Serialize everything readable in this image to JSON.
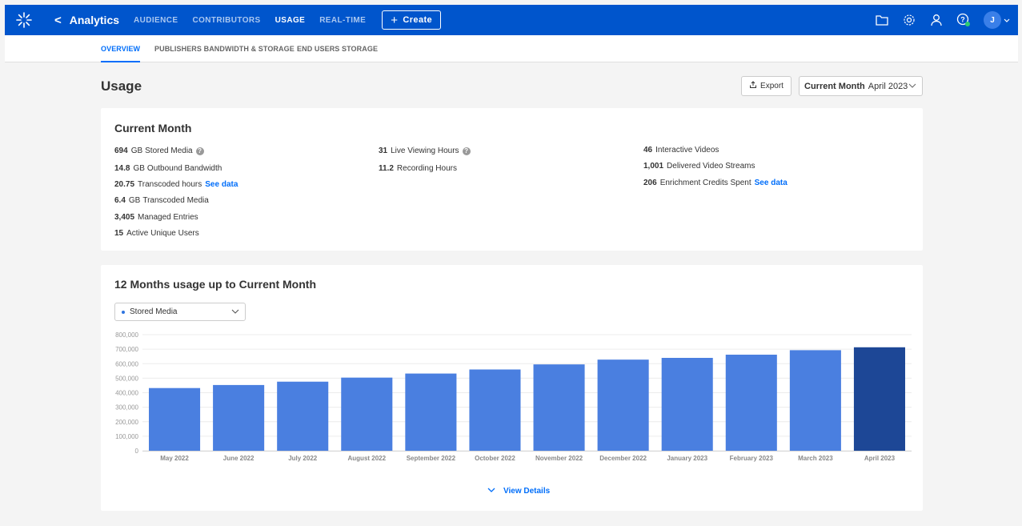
{
  "topbar": {
    "app_title": "Analytics",
    "back_glyph": "<",
    "nav": [
      "AUDIENCE",
      "CONTRIBUTORS",
      "USAGE",
      "REAL-TIME"
    ],
    "active_nav": "USAGE",
    "create_label": "Create",
    "avatar_initial": "J",
    "icons": [
      "kaltura-logo-icon",
      "folder-icon",
      "gear-icon",
      "user-icon",
      "help-icon",
      "chevron-down-icon"
    ],
    "accent_color": "#0055cc"
  },
  "subnav": {
    "tabs": [
      "OVERVIEW",
      "PUBLISHERS BANDWIDTH & STORAGE",
      "END USERS STORAGE"
    ],
    "active": "OVERVIEW"
  },
  "header": {
    "title": "Usage",
    "export_label": "Export",
    "period_label": "Current Month",
    "period_value": "April 2023"
  },
  "current_month": {
    "title": "Current Month",
    "col1": [
      {
        "value": "694",
        "unit": "GB",
        "label": "Stored Media",
        "help": true
      },
      {
        "value": "14.8",
        "unit": "GB",
        "label": "Outbound Bandwidth"
      },
      {
        "value": "20.75",
        "label": "Transcoded hours",
        "link": "See data"
      },
      {
        "value": "6.4",
        "unit": "GB",
        "label": "Transcoded Media"
      },
      {
        "value": "3,405",
        "label": "Managed Entries"
      },
      {
        "value": "15",
        "label": "Active Unique Users"
      }
    ],
    "col2": [
      {
        "value": "31",
        "label": "Live Viewing Hours",
        "help": true
      },
      {
        "value": "11.2",
        "label": "Recording Hours"
      }
    ],
    "col3": [
      {
        "value": "46",
        "label": "Interactive Videos"
      },
      {
        "value": "1,001",
        "label": "Delivered Video Streams"
      },
      {
        "value": "206",
        "label": "Enrichment Credits Spent",
        "link": "See data"
      }
    ]
  },
  "usage_chart": {
    "title": "12 Months usage up to Current Month",
    "metric_selected": "Stored Media",
    "view_details_label": "View Details"
  },
  "chart_data": {
    "type": "bar",
    "categories": [
      "May 2022",
      "June 2022",
      "July 2022",
      "August 2022",
      "September 2022",
      "October 2022",
      "November 2022",
      "December 2022",
      "January 2023",
      "February 2023",
      "March 2023",
      "April 2023"
    ],
    "values": [
      432000,
      453000,
      476000,
      504000,
      532000,
      560000,
      595000,
      628000,
      640000,
      662000,
      693000,
      713000
    ],
    "yticks": [
      "0",
      "100,000",
      "200,000",
      "300,000",
      "400,000",
      "500,000",
      "600,000",
      "700,000",
      "800,000"
    ],
    "ylim": [
      0,
      800000
    ],
    "grid": true,
    "bar_color": "#4a7fe0",
    "highlight_color": "#1d4796",
    "highlight_index": 11
  }
}
